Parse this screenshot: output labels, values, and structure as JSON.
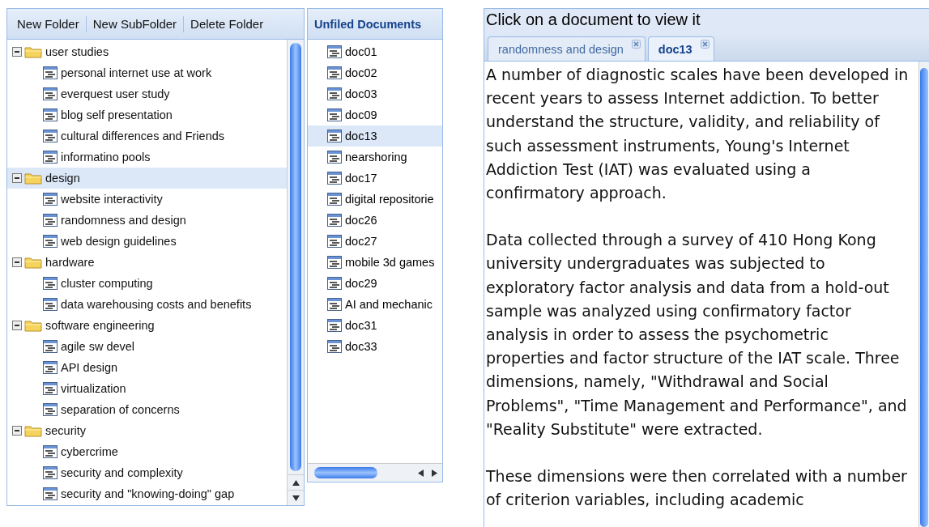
{
  "folder_toolbar": {
    "buttons": [
      "New Folder",
      "New SubFolder",
      "Delete Folder"
    ]
  },
  "folder_tree": [
    {
      "label": "user studies",
      "expanded": true,
      "selected": false,
      "children": [
        {
          "label": "personal internet use at work"
        },
        {
          "label": "everquest user study"
        },
        {
          "label": "blog self presentation"
        },
        {
          "label": "cultural differences and Friends"
        },
        {
          "label": "informatino pools"
        }
      ]
    },
    {
      "label": "design",
      "expanded": true,
      "selected": true,
      "children": [
        {
          "label": "website interactivity"
        },
        {
          "label": "randomness and design"
        },
        {
          "label": "web design guidelines"
        }
      ]
    },
    {
      "label": "hardware",
      "expanded": true,
      "selected": false,
      "children": [
        {
          "label": "cluster computing"
        },
        {
          "label": "data warehousing costs and benefits"
        }
      ]
    },
    {
      "label": "software engineering",
      "expanded": true,
      "selected": false,
      "children": [
        {
          "label": "agile sw devel"
        },
        {
          "label": "API design"
        },
        {
          "label": "virtualization"
        },
        {
          "label": "separation of concerns"
        }
      ]
    },
    {
      "label": "security",
      "expanded": true,
      "selected": false,
      "children": [
        {
          "label": "cybercrime"
        },
        {
          "label": "security and complexity"
        },
        {
          "label": "security and \"knowing-doing\" gap"
        }
      ]
    }
  ],
  "unfiled": {
    "title": "Unfiled Documents",
    "items": [
      {
        "label": "doc01",
        "selected": false
      },
      {
        "label": "doc02",
        "selected": false
      },
      {
        "label": "doc03",
        "selected": false
      },
      {
        "label": "doc09",
        "selected": false
      },
      {
        "label": "doc13",
        "selected": true
      },
      {
        "label": "nearshoring",
        "selected": false
      },
      {
        "label": "doc17",
        "selected": false
      },
      {
        "label": "digital repositorie",
        "selected": false
      },
      {
        "label": "doc26",
        "selected": false
      },
      {
        "label": "doc27",
        "selected": false
      },
      {
        "label": "mobile 3d games",
        "selected": false
      },
      {
        "label": "doc29",
        "selected": false
      },
      {
        "label": "AI and mechanic",
        "selected": false
      },
      {
        "label": "doc31",
        "selected": false
      },
      {
        "label": "doc33",
        "selected": false
      }
    ]
  },
  "viewer": {
    "title": "Click on a document to view it",
    "tabs": [
      {
        "label": "randomness and design",
        "selected": false
      },
      {
        "label": "doc13",
        "selected": true
      }
    ],
    "paragraphs": [
      "A number of diagnostic scales have been developed in recent years to assess Internet addiction. To better understand the structure, validity, and reliability of such assessment instruments, Young's Internet Addiction Test (IAT) was evaluated using a confirmatory approach.",
      "Data collected through a survey of 410 Hong Kong university undergraduates was subjected to exploratory factor analysis and data from a hold-out sample was analyzed using confirmatory factor analysis in order to assess the psychometric properties and factor structure of the IAT scale. Three dimensions, namely, \"Withdrawal and Social Problems\", \"Time Management and Performance\", and \"Reality Substitute\" were extracted.",
      "These dimensions were then correlated with a number of criterion variables, including academic"
    ]
  }
}
